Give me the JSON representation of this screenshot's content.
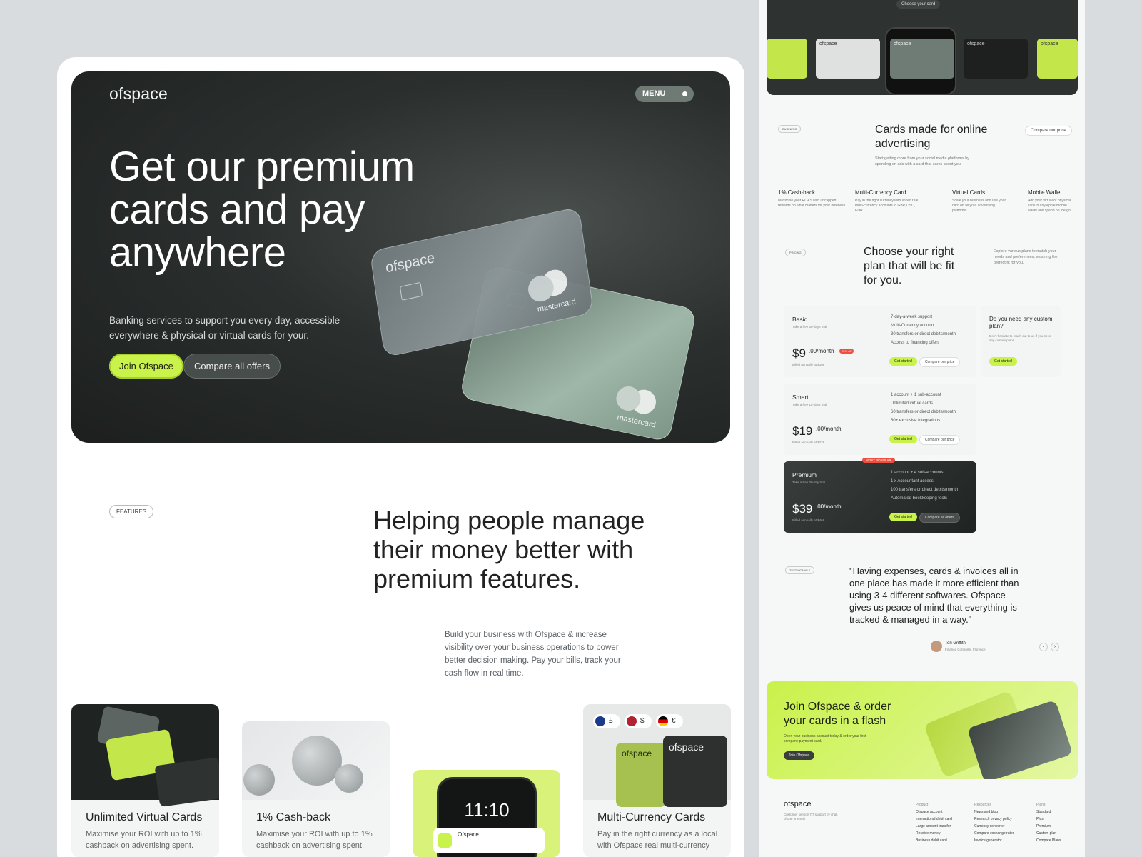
{
  "brand": "ofspace",
  "hero": {
    "menu_label": "MENU",
    "headline": "Get our premium cards and pay anywhere",
    "subtext": "Banking services to support you every day, accessible everywhere & physical or virtual cards for your.",
    "join_label": "Join Ofspace",
    "compare_label": "Compare all offers",
    "card_brand": "ofspace",
    "card_network": "mastercard"
  },
  "features": {
    "tag": "FEATURES",
    "heading": "Helping people manage their money better with premium features.",
    "description": "Build your business with Ofspace & increase visibility over your business operations to power better decision making. Pay your bills, track your cash flow in real time.",
    "cards": [
      {
        "title": "Unlimited Virtual Cards",
        "text": "Maximise your ROI with up to 1% cashback on advertising spent. Get uncapped rewards on what matters"
      },
      {
        "title": "1% Cash-back",
        "text": "Maximise your ROI with up to 1% cashback on advertising spent. Get"
      },
      {
        "title": "",
        "text": ""
      },
      {
        "title": "Multi-Currency Cards",
        "text": "Pay in the right currency as a local with Ofspace real multi-currency accounts GBP, USD, EUR, Fund"
      }
    ],
    "phone_time": "11:10",
    "phone_notification": "Ofspace",
    "currencies": [
      "£",
      "$",
      "€"
    ]
  },
  "right": {
    "choose_card_label": "Choose your card",
    "mini_card_brand": "ofspace",
    "business_tag": "BUSINESS",
    "business_heading": "Cards made for online advertising",
    "business_text": "Start getting more from your social media platforms by spending on ads with a card that cares about you.",
    "compare_price_label": "Compare our price",
    "benefits": [
      {
        "title": "1% Cash-back",
        "text": "Maximise your ROAS with uncapped rewards on what matters for your business."
      },
      {
        "title": "Multi-Currency Card",
        "text": "Pay in the right currency with linked real multi-currency accounts in GBP, USD, EUR."
      },
      {
        "title": "Virtual Cards",
        "text": "Scale your business and use your card on all your advertising platforms."
      },
      {
        "title": "Mobile Wallet",
        "text": "Add your virtual or physical card to any Apple mobile wallet and spend on the go."
      }
    ],
    "pricing_tag": "PRICING",
    "pricing_heading": "Choose your right plan that will be fit for you.",
    "pricing_text": "Explore various plans to match your needs and preferences, ensuring the perfect fit for you.",
    "plans": [
      {
        "name": "Basic",
        "trial": "Take a free 30-days trial",
        "price": "$9",
        "period": ".00/month",
        "billed": "Billed annually at $108",
        "badge": "20% off",
        "features": [
          "7-day-a-week support",
          "Multi-Currency account",
          "30 transfers or direct debits/month",
          "Access to financing offers"
        ],
        "cta": "Get started",
        "compare": "Compare our price"
      },
      {
        "name": "Smart",
        "trial": "Take a free 15-days trial",
        "price": "$19",
        "period": ".00/month",
        "billed": "Billed annually at $228",
        "badge": "",
        "features": [
          "1 account + 1 sub-account",
          "Unlimited virtual cards",
          "60 transfers or direct debits/month",
          "60+ exclusive integrations"
        ],
        "cta": "Get started",
        "compare": "Compare our price"
      },
      {
        "name": "Premium",
        "trial": "Take a free 30-day trial",
        "price": "$39",
        "period": ".00/month",
        "billed": "Billed annually at $468",
        "badge": "MOST POPULAR",
        "features": [
          "1 account + 4 sub-accounts",
          "1 x Accountant access",
          "100 transfers or direct debits/month",
          "Automated bookkeeping tools"
        ],
        "cta": "Get started",
        "compare": "Compare all offers"
      }
    ],
    "custom": {
      "title": "Do you need any custom plan?",
      "text": "Don't hesitate to reach out to us if you need any custom plans.",
      "cta": "Get started"
    },
    "testimonial_tag": "TESTIMONIALS",
    "quote": "\"Having expenses, cards & invoices all in one place has made it more efficient than using 3-4 different softwares. Ofspace gives us peace of mind that everything is tracked & managed in a way.\"",
    "author": "Tori Griffith",
    "author_role": "Finance Controller, Florence",
    "cta_heading": "Join Ofspace & order your cards in a flash",
    "cta_text": "Open your business account today & order your first company payment card.",
    "cta_button": "Join Ofspace",
    "footer": {
      "brand": "ofspace",
      "tagline": "Customer service 7/7 support by chat, phone or email",
      "cols": [
        {
          "title": "Product",
          "items": [
            "Ofspace account",
            "International debit card",
            "Large amount transfer",
            "Receive money",
            "Business debit card"
          ]
        },
        {
          "title": "Resources",
          "items": [
            "News and blog",
            "Research privacy policy",
            "Currency converter",
            "Compare exchange rates",
            "Invoice generator"
          ]
        },
        {
          "title": "Plans",
          "items": [
            "Standard",
            "Plus",
            "Premium",
            "Custom plan",
            "Compare Plans"
          ]
        }
      ]
    }
  },
  "colors": {
    "accent": "#c9f24a",
    "dark": "#1f2321",
    "badge_red": "#f04e3e"
  }
}
